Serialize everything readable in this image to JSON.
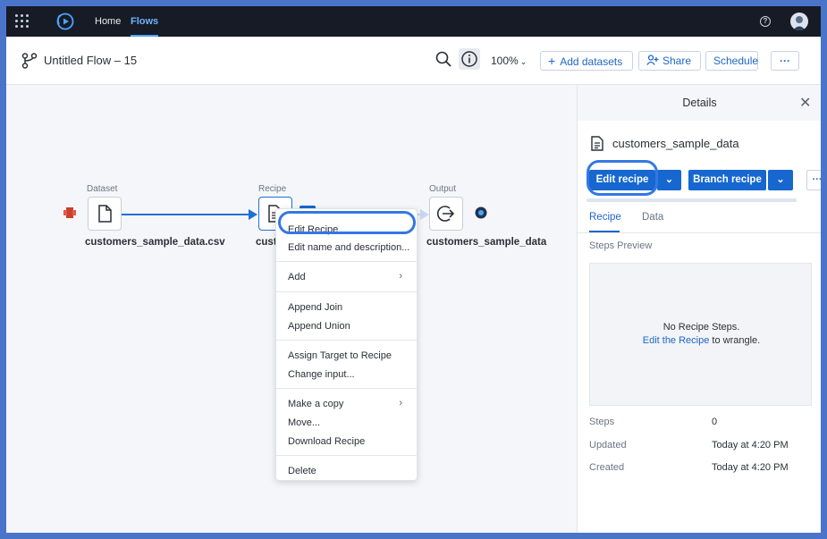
{
  "nav": {
    "home": "Home",
    "flows": "Flows",
    "help_glyph": "?"
  },
  "toolbar": {
    "title": "Untitled Flow – 15",
    "zoom": "100%",
    "add_datasets": "Add datasets",
    "share": "Share",
    "schedule": "Schedule",
    "more": "···"
  },
  "canvas": {
    "dataset": {
      "label": "Dataset",
      "name": "customers_sample_data.csv"
    },
    "recipe": {
      "label": "Recipe",
      "name": "cust"
    },
    "output": {
      "label": "Output",
      "name": "customers_sample_data"
    }
  },
  "context_menu": {
    "items": [
      {
        "label": "Edit Recipe"
      },
      {
        "label": "Edit name and description..."
      },
      {
        "label": "Add"
      },
      {
        "label": "Append Join"
      },
      {
        "label": "Append Union"
      },
      {
        "label": "Assign Target to Recipe"
      },
      {
        "label": "Change input..."
      },
      {
        "label": "Make a copy"
      },
      {
        "label": "Move..."
      },
      {
        "label": "Download Recipe"
      },
      {
        "label": "Delete"
      }
    ]
  },
  "details": {
    "title": "Details",
    "dataset_name": "customers_sample_data",
    "edit_recipe": "Edit recipe",
    "branch_recipe": "Branch recipe",
    "more": "···",
    "tabs": [
      "Recipe",
      "Data"
    ],
    "steps_preview": "Steps Preview",
    "no_steps": "No Recipe Steps.",
    "edit_link": "Edit the Recipe",
    "edit_suffix": " to wrangle.",
    "meta": [
      {
        "key": "Steps",
        "value": "0"
      },
      {
        "key": "Updated",
        "value": "Today at 4:20 PM"
      },
      {
        "key": "Created",
        "value": "Today at 4:20 PM"
      }
    ]
  },
  "colors": {
    "accent": "#1667d0",
    "highlight": "#3377e3",
    "nav_bg": "#161b25",
    "border_bg": "#4a74c9"
  },
  "icons": [
    "grid-icon",
    "brand-logo-icon",
    "help-icon",
    "flow-icon",
    "search-icon",
    "info-icon",
    "plus-icon",
    "add-user-icon",
    "file-icon",
    "recipe-icon",
    "output-icon",
    "chevron-right-icon",
    "chevron-down-icon",
    "close-icon",
    "document-icon"
  ]
}
